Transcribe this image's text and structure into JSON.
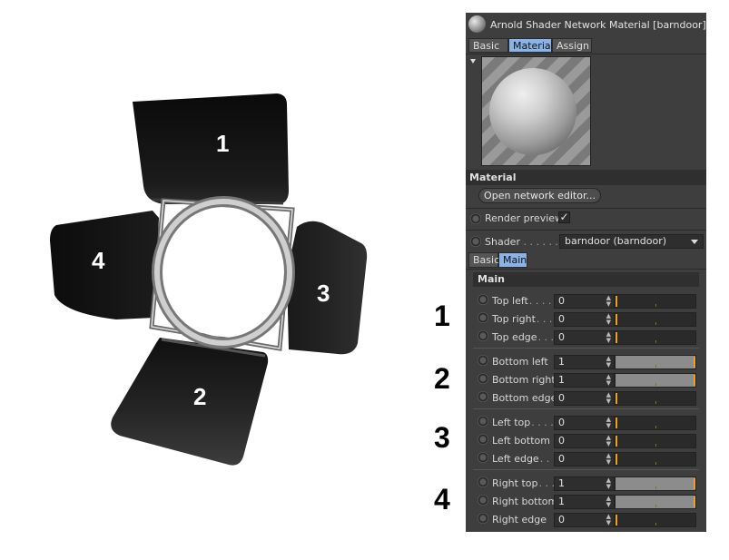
{
  "callouts": {
    "image": [
      "1",
      "2",
      "3",
      "4"
    ],
    "panel": [
      "1",
      "2",
      "3",
      "4"
    ]
  },
  "panel": {
    "title": "Arnold Shader Network Material [barndoor]",
    "tabs": [
      "Basic",
      "Material",
      "Assign"
    ],
    "active_tab": "Material",
    "section_title": "Material",
    "open_editor_label": "Open network editor...",
    "render_preview_label": "Render preview",
    "render_preview_checked": true,
    "shader_label": "Shader",
    "shader_dots": ". . . . . .",
    "shader_value": "barndoor (barndoor)",
    "sub_tabs": [
      "Basic",
      "Main"
    ],
    "active_sub_tab": "Main",
    "group_title": "Main",
    "groups": [
      [
        {
          "label": "Top left",
          "dots": " . . . .",
          "value": "0",
          "level": 0
        },
        {
          "label": "Top right",
          "dots": " . . .",
          "value": "0",
          "level": 0
        },
        {
          "label": "Top edge",
          "dots": " . . .",
          "value": "0",
          "level": 0
        }
      ],
      [
        {
          "label": "Bottom left",
          "dots": "",
          "value": "1",
          "level": 1
        },
        {
          "label": "Bottom right",
          "dots": "",
          "value": "1",
          "level": 1
        },
        {
          "label": "Bottom edge",
          "dots": "",
          "value": "0",
          "level": 0
        }
      ],
      [
        {
          "label": "Left top",
          "dots": " . . . .",
          "value": "0",
          "level": 0
        },
        {
          "label": "Left bottom",
          "dots": "",
          "value": "0",
          "level": 0
        },
        {
          "label": "Left edge",
          "dots": " . .",
          "value": "0",
          "level": 0
        }
      ],
      [
        {
          "label": "Right top",
          "dots": " . . .",
          "value": "1",
          "level": 1
        },
        {
          "label": "Right bottom",
          "dots": "",
          "value": "1",
          "level": 1
        },
        {
          "label": "Right edge",
          "dots": "",
          "value": "0",
          "level": 0
        }
      ]
    ]
  },
  "colors": {
    "panel_bg": "#3e3e3e",
    "active_tab": "#8ab4e8",
    "slider_knob": "#f0a020"
  }
}
